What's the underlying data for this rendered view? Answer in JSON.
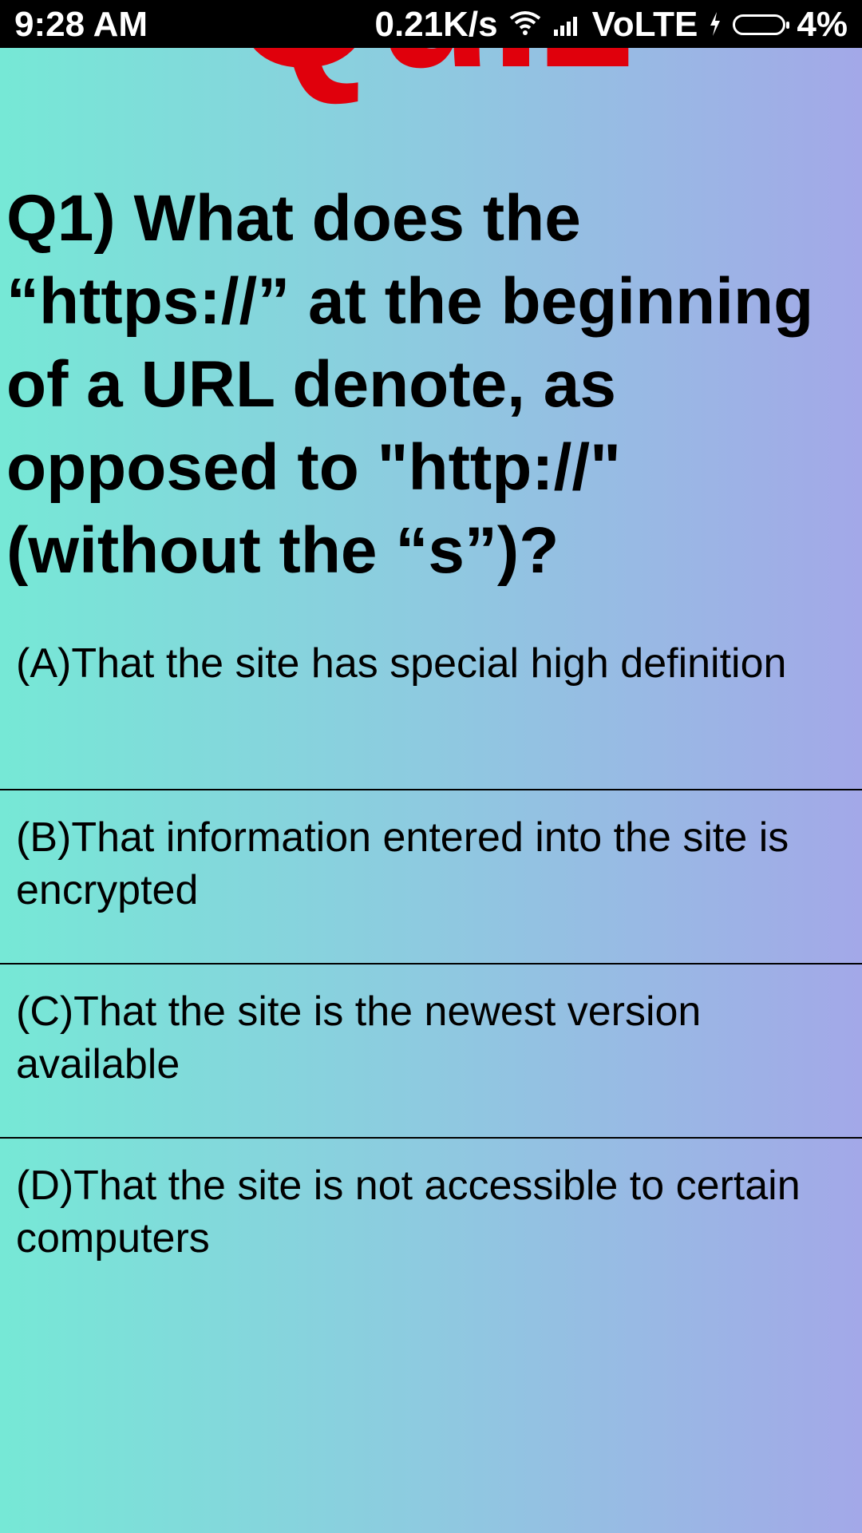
{
  "status_bar": {
    "time": "9:28 AM",
    "net_speed": "0.21K/s",
    "network_type": "VoLTE",
    "battery_percent": "4%"
  },
  "header": {
    "logo_text": "Quiz"
  },
  "question": {
    "text": "Q1) What does the “https://” at the beginning of a URL denote, as opposed to \"http://\" (without the “s”)?"
  },
  "options": [
    {
      "label": "(A)That the site has special high definition"
    },
    {
      "label": "(B)That information entered into the site is encrypted"
    },
    {
      "label": "(C)That the site is the newest version available"
    },
    {
      "label": "(D)That the site is not accessible to certain computers"
    }
  ],
  "colors": {
    "logo": "#e0000c",
    "gradient_left": "#76e8d6",
    "gradient_right": "#a3a8e8"
  }
}
